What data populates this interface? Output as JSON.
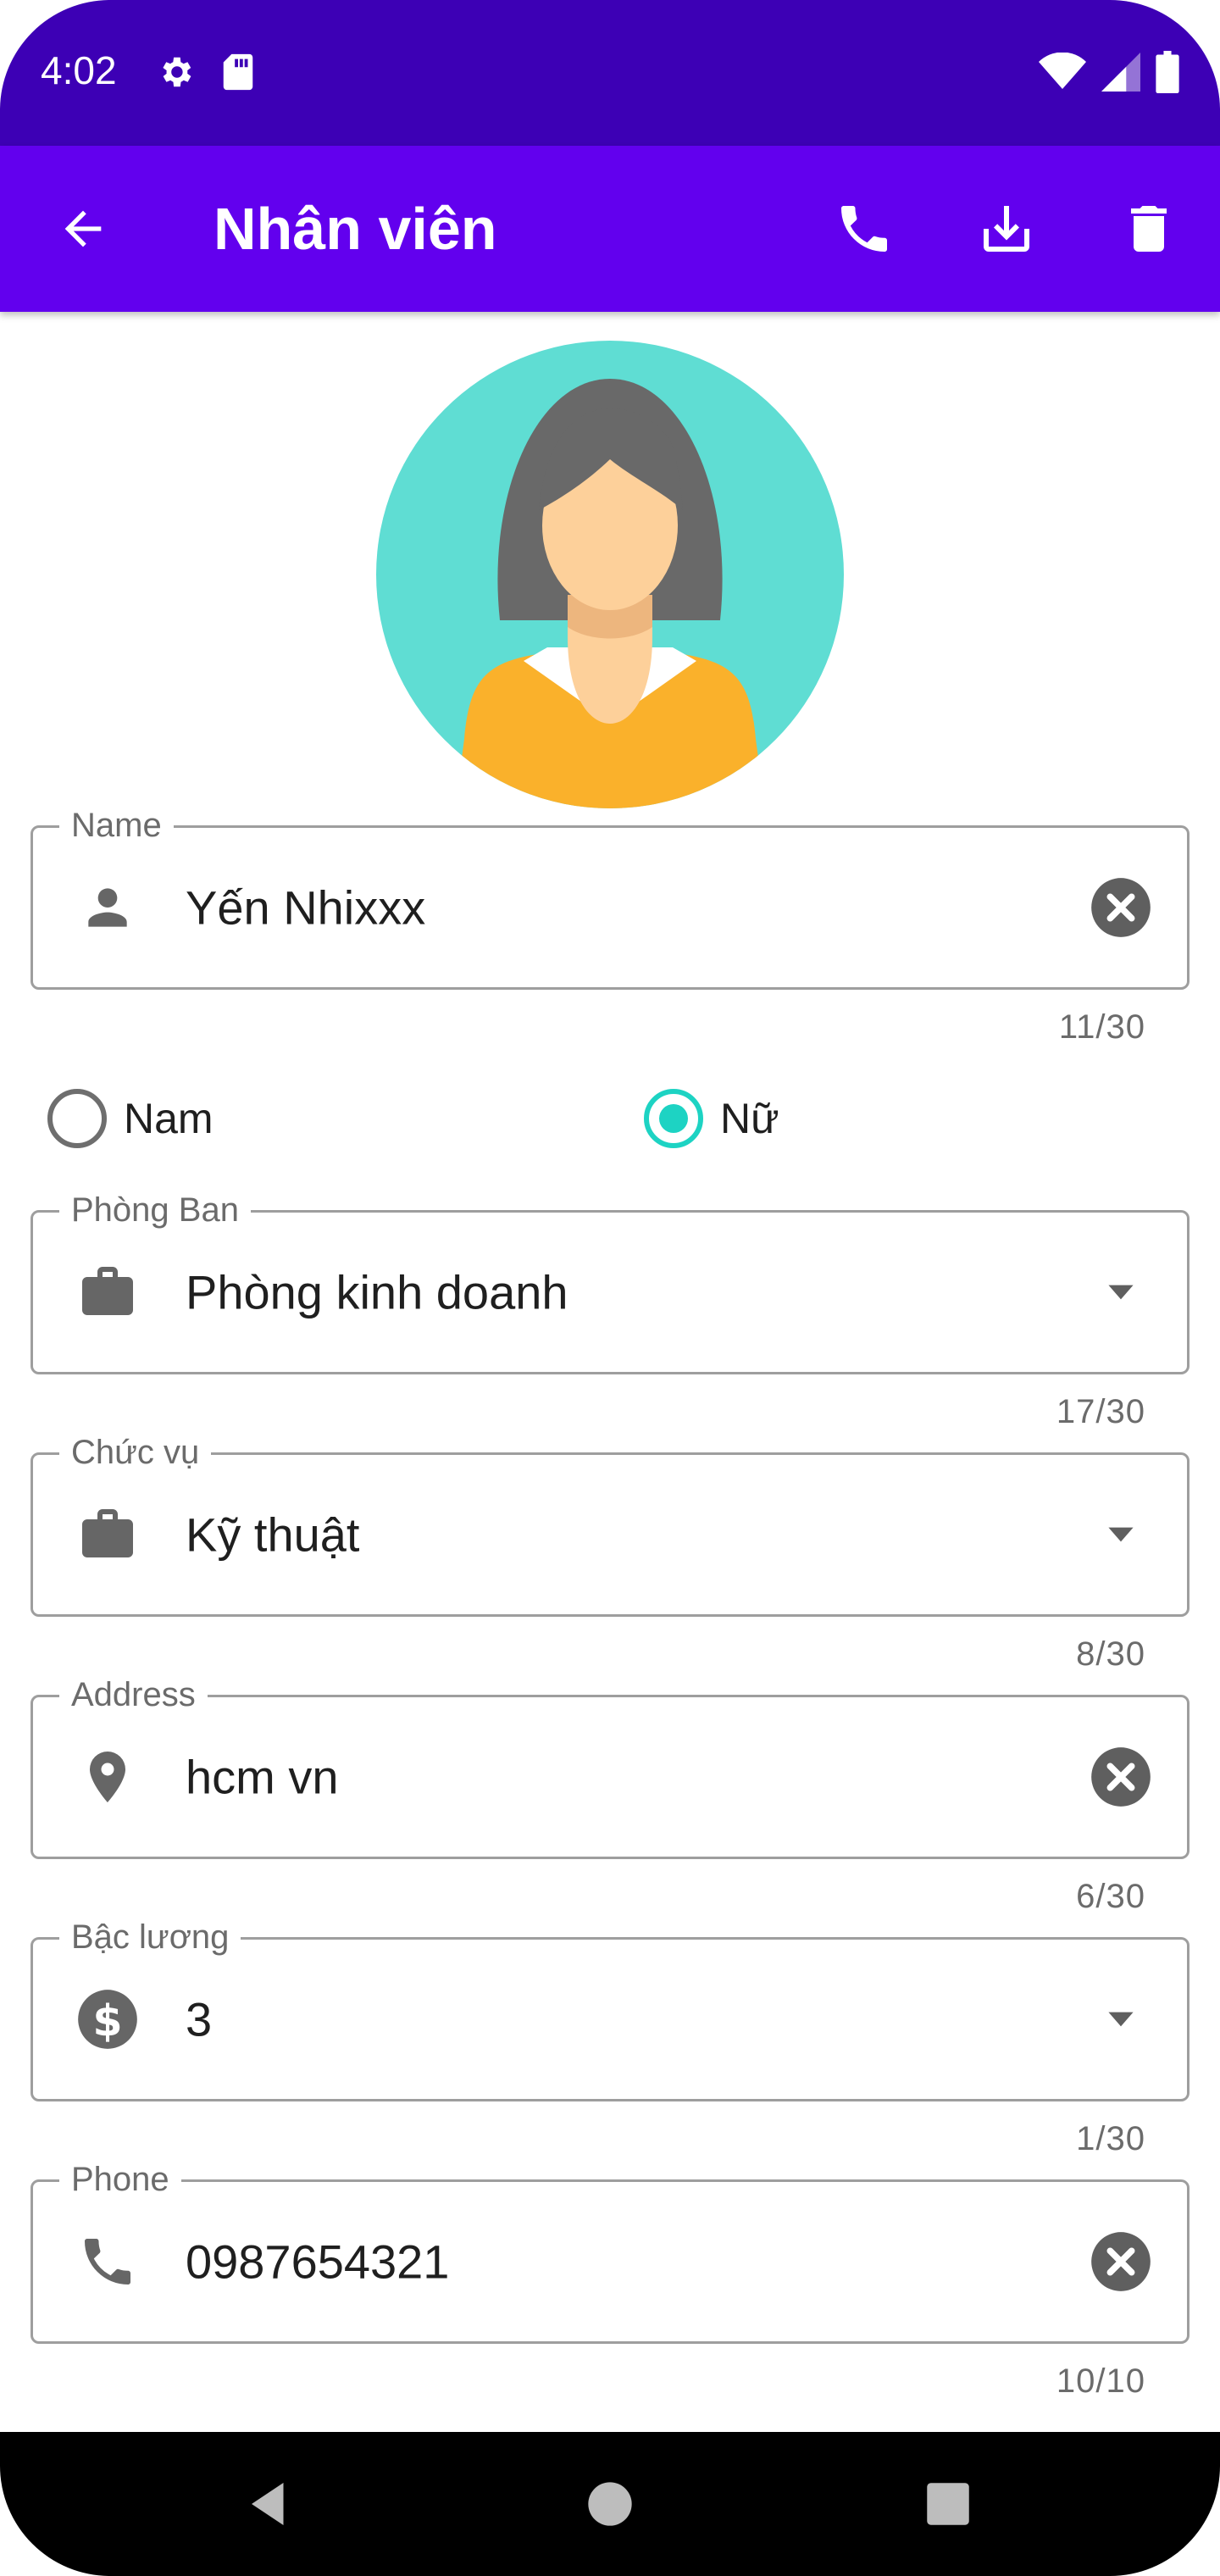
{
  "status_bar": {
    "time": "4:02",
    "icons": [
      "gear-icon",
      "sd-card-icon",
      "wifi-icon",
      "signal-icon",
      "battery-icon"
    ]
  },
  "app_bar": {
    "title": "Nhân viên",
    "actions": [
      "phone-icon",
      "download-icon",
      "delete-icon"
    ]
  },
  "colors": {
    "status_bar": "#3d00b5",
    "app_bar": "#6200ee",
    "accent": "#1dd3c3",
    "avatar_bg": "#5fddd3"
  },
  "form": {
    "name": {
      "label": "Name",
      "value": "Yến Nhixxx",
      "counter": "11/30",
      "icon": "person-icon",
      "trailing": "clear-icon"
    },
    "gender": {
      "options": [
        {
          "label": "Nam",
          "checked": false
        },
        {
          "label": "Nữ",
          "checked": true
        }
      ]
    },
    "department": {
      "label": "Phòng Ban",
      "value": "Phòng kinh doanh",
      "counter": "17/30",
      "icon": "briefcase-icon",
      "trailing": "dropdown-arrow-icon"
    },
    "position": {
      "label": "Chức vụ",
      "value": "Kỹ thuật",
      "counter": "8/30",
      "icon": "briefcase-icon",
      "trailing": "dropdown-arrow-icon"
    },
    "address": {
      "label": "Address",
      "value": "hcm vn",
      "counter": "6/30",
      "icon": "location-pin-icon",
      "trailing": "clear-icon"
    },
    "salary_level": {
      "label": "Bậc lương",
      "value": "3",
      "counter": "1/30",
      "icon": "dollar-icon",
      "trailing": "dropdown-arrow-icon"
    },
    "phone": {
      "label": "Phone",
      "value": "0987654321",
      "counter": "10/10",
      "icon": "phone-icon",
      "trailing": "clear-icon"
    }
  },
  "nav_bar": {
    "buttons": [
      "back-triangle-icon",
      "home-circle-icon",
      "recents-square-icon"
    ]
  }
}
